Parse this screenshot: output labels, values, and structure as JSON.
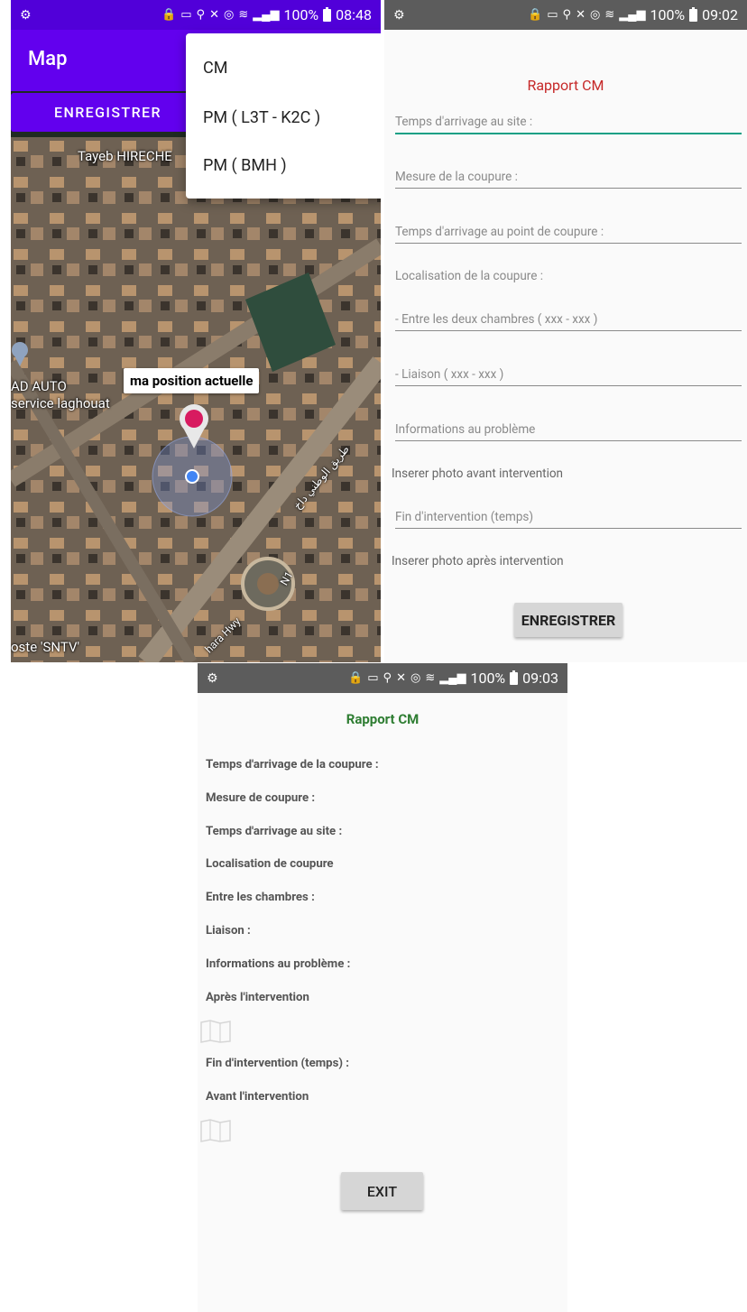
{
  "panel1": {
    "status": {
      "battery": "100%",
      "time": "08:48"
    },
    "appbar_title": "Map",
    "enregistrer_label": "ENREGISTRER",
    "menu": [
      "CM",
      "PM ( L3T - K2C )",
      "PM ( BMH )"
    ],
    "map_labels": {
      "tayeb": "Tayeb HIRECHE",
      "auto": "AD AUTO",
      "service": "service laghouat",
      "snvt": "oste 'SNTV'",
      "hwy": "hara Hwy",
      "n1": "N1",
      "arabic": "طريق الوطني داخ"
    },
    "info_window": "ma position actuelle",
    "colors": {
      "primary": "#6200ee",
      "status": "#5100d9"
    }
  },
  "panel2": {
    "status": {
      "battery": "100%",
      "time": "09:02"
    },
    "title": "Rapport CM",
    "fields": {
      "f1": "Temps d'arrivage au site :",
      "f2": "Mesure de la coupure :",
      "f3": "Temps d'arrivage au point de coupure :",
      "loc": "Localisation de la coupure :",
      "f4": "- Entre les deux chambres ( xxx - xxx )",
      "f5": "- Liaison ( xxx - xxx )",
      "f6": "Informations au problème",
      "photo_avant": "Inserer photo avant intervention",
      "f7": "Fin d'intervention (temps)",
      "photo_apres": "Inserer photo après intervention"
    },
    "enregistrer_label": "ENREGISTRER",
    "colors": {
      "title": "#c62828",
      "focus": "#16a085"
    }
  },
  "panel3": {
    "status": {
      "battery": "100%",
      "time": "09:03"
    },
    "title": "Rapport CM",
    "labels": {
      "l1": "Temps d'arrivage de la coupure :",
      "l2": "Mesure de coupure :",
      "l3": "Temps d'arrivage au site :",
      "l4": "Localisation de coupure",
      "l5": "Entre les chambres :",
      "l6": "Liaison :",
      "l7": "Informations au problème :",
      "l8": "Après l'intervention",
      "l9": "Fin d'intervention (temps) :",
      "l10": "Avant l'intervention"
    },
    "exit_label": "EXIT",
    "colors": {
      "title": "#2e7d32"
    }
  }
}
